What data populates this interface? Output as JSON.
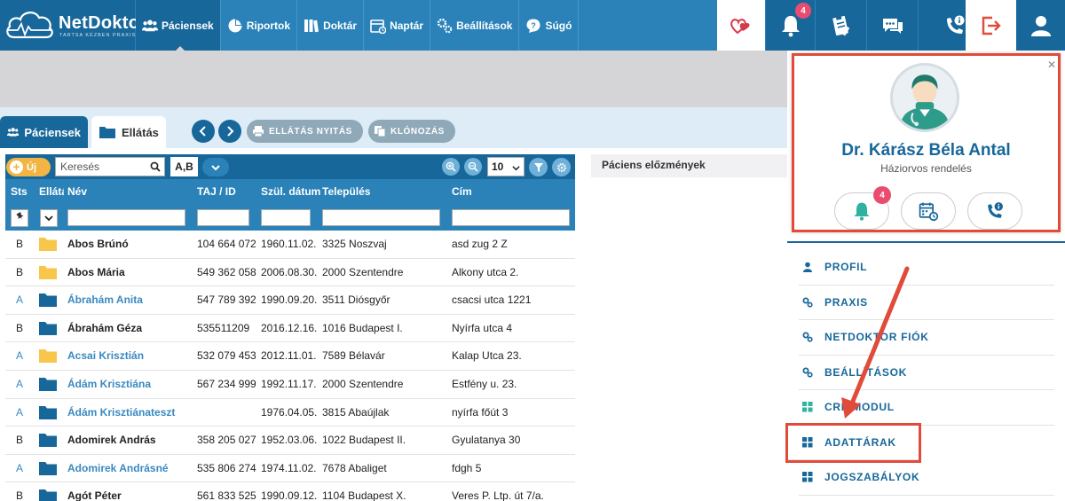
{
  "app": {
    "brand": "NetDoktor",
    "tagline": "TARTSA KÉZBEN PRAXISÁT!"
  },
  "nav": {
    "items": [
      {
        "label": "Páciensek",
        "icon": "patients-icon",
        "active": true
      },
      {
        "label": "Riportok",
        "icon": "pie-chart-icon",
        "active": false
      },
      {
        "label": "Doktár",
        "icon": "books-icon",
        "active": false
      },
      {
        "label": "Naptár",
        "icon": "calendar-icon",
        "active": false
      },
      {
        "label": "Beállítások",
        "icon": "gears-icon",
        "active": false
      },
      {
        "label": "Súgó",
        "icon": "help-icon",
        "active": false
      }
    ],
    "notification_count": "4"
  },
  "tabs": {
    "patients": "Páciensek",
    "care": "Ellátás"
  },
  "actions": {
    "open_care": "ELLÁTÁS NYITÁS",
    "clone": "KLÓNOZÁS"
  },
  "toolbar": {
    "new_label": "Új",
    "search_placeholder": "Keresés",
    "ab_label": "A,B",
    "page_size": "10"
  },
  "table": {
    "headers": [
      "Sts",
      "Ellátás",
      "Név",
      "TAJ / ID",
      "Szül. dátum",
      "Település",
      "Cím"
    ],
    "rows": [
      {
        "sts": "B",
        "folder": "yellow",
        "name": "Abos Brúnó",
        "taj": "104 664 072",
        "dob": "1960.11.02.",
        "town": "3325 Noszvaj",
        "addr": "asd zug 2 Z"
      },
      {
        "sts": "B",
        "folder": "yellow",
        "name": "Abos Mária",
        "taj": "549 362 058",
        "dob": "2006.08.30.",
        "town": "2000 Szentendre",
        "addr": "Alkony utca 2."
      },
      {
        "sts": "A",
        "folder": "blue",
        "name": "Ábrahám Anita",
        "taj": "547 789 392",
        "dob": "1990.09.20.",
        "town": "3511 Diósgyőr",
        "addr": "csacsi utca 1221"
      },
      {
        "sts": "B",
        "folder": "blue",
        "name": "Ábrahám Géza",
        "taj": "535511209",
        "dob": "2016.12.16.",
        "town": "1016 Budapest I.",
        "addr": "Nyírfa utca 4"
      },
      {
        "sts": "A",
        "folder": "yellow",
        "name": "Acsai Krisztián",
        "taj": "532 079 453",
        "dob": "2012.11.01.",
        "town": "7589 Bélavár",
        "addr": "Kalap Utca 23."
      },
      {
        "sts": "A",
        "folder": "blue",
        "name": "Ádám Krisztiána",
        "taj": "567 234 999",
        "dob": "1992.11.17.",
        "town": "2000 Szentendre",
        "addr": "Estfény u. 23."
      },
      {
        "sts": "A",
        "folder": "blue",
        "name": "Ádám Krisztiánateszt",
        "taj": "",
        "dob": "1976.04.05.",
        "town": "3815 Abaújlak",
        "addr": "nyírfa főút 3"
      },
      {
        "sts": "B",
        "folder": "blue",
        "name": "Adomirek András",
        "taj": "358 205 027",
        "dob": "1952.03.06.",
        "town": "1022 Budapest II.",
        "addr": "Gyulatanya 30"
      },
      {
        "sts": "A",
        "folder": "blue",
        "name": "Adomirek Andrásné",
        "taj": "535 806 274",
        "dob": "1974.11.02.",
        "town": "7678 Abaliget",
        "addr": "fdgh 5"
      },
      {
        "sts": "B",
        "folder": "blue",
        "name": "Agót Péter",
        "taj": "561 833 525",
        "dob": "1990.09.12.",
        "town": "1104 Budapest X.",
        "addr": "Veres P. Ltp. út 7/a."
      }
    ]
  },
  "history": {
    "title": "Páciens előzmények"
  },
  "profile": {
    "name": "Dr. Kárász Béla Antal",
    "role": "Háziorvos rendelés",
    "notification_count": "4"
  },
  "menu": {
    "items": [
      {
        "label": "PROFIL",
        "icon": "user-icon"
      },
      {
        "label": "PRAXIS",
        "icon": "gears-icon"
      },
      {
        "label": "NETDOKTOR FIÓK",
        "icon": "gears-icon"
      },
      {
        "label": "BEÁLLÍTÁSOK",
        "icon": "gears-icon"
      },
      {
        "label": "CRP MODUL",
        "icon": "grid-icon"
      },
      {
        "label": "ADATTÁRAK",
        "icon": "grid-icon"
      },
      {
        "label": "JOGSZABÁLYOK",
        "icon": "grid-icon"
      }
    ]
  },
  "colors": {
    "primary": "#2a82b8",
    "primary_dark": "#17679a",
    "accent_red": "#e04b3a",
    "badge_pink": "#ea4c6f",
    "folder_yellow": "#f8c64a",
    "folder_blue": "#17679a"
  }
}
